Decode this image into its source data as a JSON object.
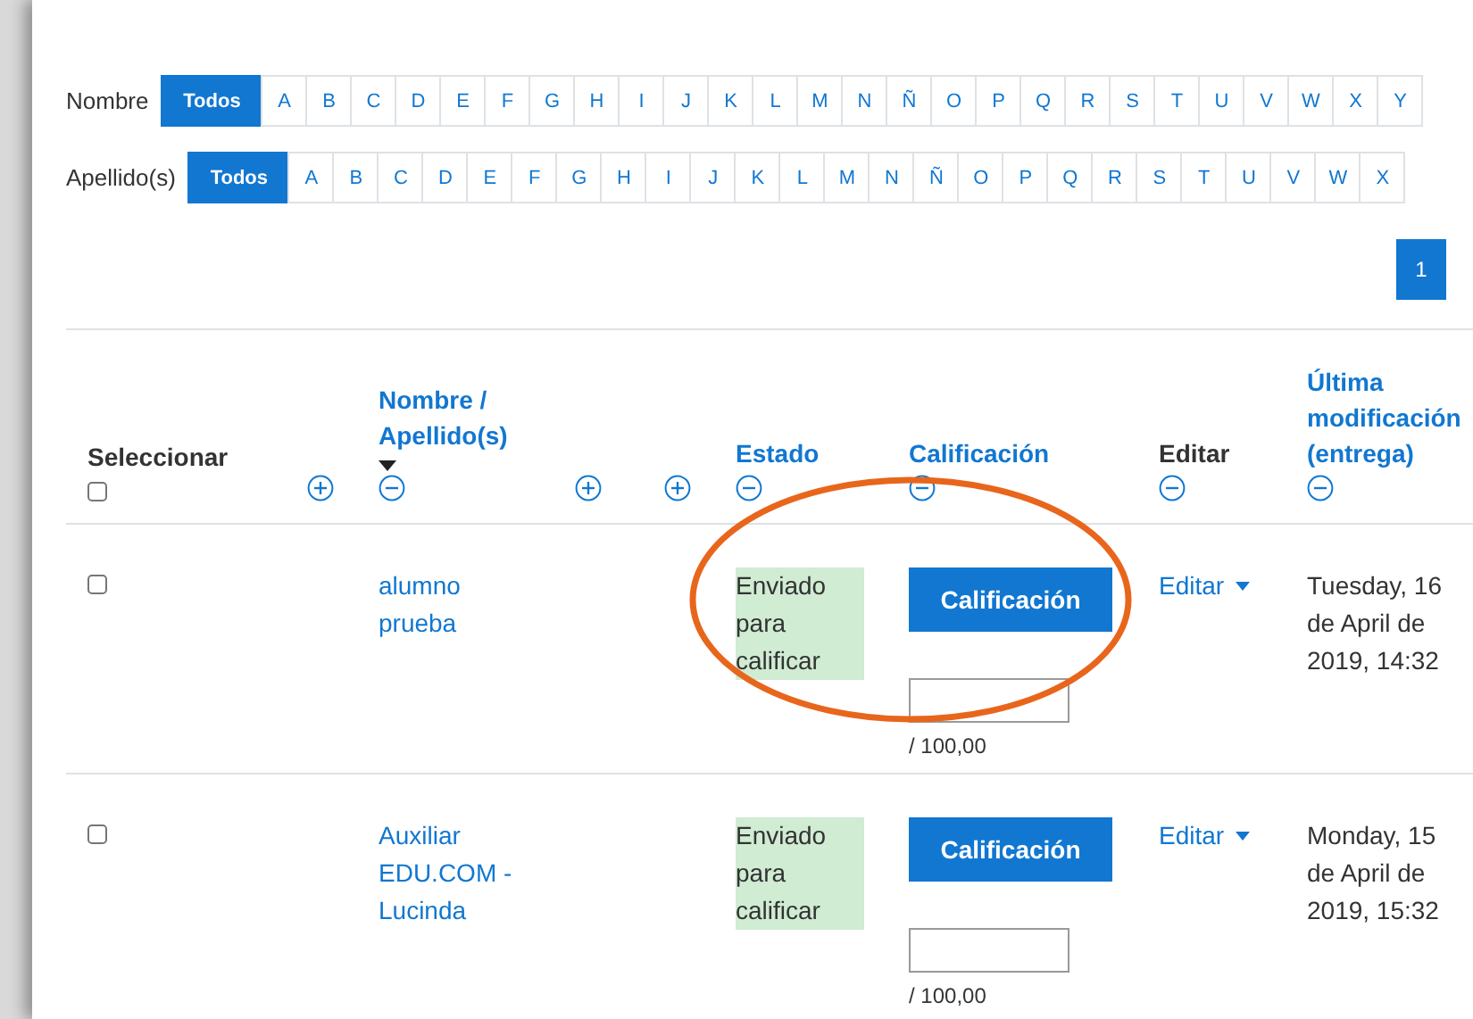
{
  "filters": [
    {
      "label": "Nombre",
      "letters": [
        {
          "text": "Todos",
          "selected": true
        },
        {
          "text": "A",
          "selected": false
        },
        {
          "text": "B",
          "selected": false
        },
        {
          "text": "C",
          "selected": false
        },
        {
          "text": "D",
          "selected": false
        },
        {
          "text": "E",
          "selected": false
        },
        {
          "text": "F",
          "selected": false
        },
        {
          "text": "G",
          "selected": false
        },
        {
          "text": "H",
          "selected": false
        },
        {
          "text": "I",
          "selected": false
        },
        {
          "text": "J",
          "selected": false
        },
        {
          "text": "K",
          "selected": false
        },
        {
          "text": "L",
          "selected": false
        },
        {
          "text": "M",
          "selected": false
        },
        {
          "text": "N",
          "selected": false
        },
        {
          "text": "Ñ",
          "selected": false
        },
        {
          "text": "O",
          "selected": false
        },
        {
          "text": "P",
          "selected": false
        },
        {
          "text": "Q",
          "selected": false
        },
        {
          "text": "R",
          "selected": false
        },
        {
          "text": "S",
          "selected": false
        },
        {
          "text": "T",
          "selected": false
        },
        {
          "text": "U",
          "selected": false
        },
        {
          "text": "V",
          "selected": false
        },
        {
          "text": "W",
          "selected": false
        },
        {
          "text": "X",
          "selected": false
        },
        {
          "text": "Y",
          "selected": false
        }
      ]
    },
    {
      "label": "Apellido(s)",
      "letters": [
        {
          "text": "Todos",
          "selected": true
        },
        {
          "text": "A",
          "selected": false
        },
        {
          "text": "B",
          "selected": false
        },
        {
          "text": "C",
          "selected": false
        },
        {
          "text": "D",
          "selected": false
        },
        {
          "text": "E",
          "selected": false
        },
        {
          "text": "F",
          "selected": false
        },
        {
          "text": "G",
          "selected": false
        },
        {
          "text": "H",
          "selected": false
        },
        {
          "text": "I",
          "selected": false
        },
        {
          "text": "J",
          "selected": false
        },
        {
          "text": "K",
          "selected": false
        },
        {
          "text": "L",
          "selected": false
        },
        {
          "text": "M",
          "selected": false
        },
        {
          "text": "N",
          "selected": false
        },
        {
          "text": "Ñ",
          "selected": false
        },
        {
          "text": "O",
          "selected": false
        },
        {
          "text": "P",
          "selected": false
        },
        {
          "text": "Q",
          "selected": false
        },
        {
          "text": "R",
          "selected": false
        },
        {
          "text": "S",
          "selected": false
        },
        {
          "text": "T",
          "selected": false
        },
        {
          "text": "U",
          "selected": false
        },
        {
          "text": "V",
          "selected": false
        },
        {
          "text": "W",
          "selected": false
        },
        {
          "text": "X",
          "selected": false
        }
      ]
    }
  ],
  "pagination": [
    {
      "text": "1",
      "selected": true
    }
  ],
  "table": {
    "columns": [
      {
        "kind": "select",
        "label": "Seleccionar",
        "checked": false
      },
      {
        "kind": "toggle",
        "collapsed": true
      },
      {
        "kind": "sort",
        "label": "Nombre / Apellido(s)",
        "sorted": true,
        "collapsed": false
      },
      {
        "kind": "toggle",
        "collapsed": true
      },
      {
        "kind": "toggle",
        "collapsed": true
      },
      {
        "kind": "sort",
        "label": "Estado",
        "sorted": false,
        "collapsed": false
      },
      {
        "kind": "sort",
        "label": "Calificación",
        "sorted": false,
        "collapsed": false
      },
      {
        "kind": "label",
        "label": "Editar",
        "collapsed": false
      },
      {
        "kind": "sort",
        "label": "Última modificación (entrega)",
        "sorted": false,
        "collapsed": false
      }
    ],
    "rows": [
      {
        "checked": false,
        "name": "alumno prueba",
        "status": "Enviado para calificar",
        "grade_button": "Calificación",
        "grade_max": "/ 100,00",
        "edit": "Editar",
        "modified": "Tuesday, 16 de April de 2019, 14:32"
      },
      {
        "checked": false,
        "name": "Auxiliar EDU.COM - Lucinda",
        "status": "Enviado para calificar",
        "grade_button": "Calificación",
        "grade_max": "/ 100,00",
        "edit": "Editar",
        "modified": "Monday, 15 de April de 2019, 15:32"
      }
    ]
  },
  "annotation": {
    "kind": "ellipse",
    "color": "#e8661c"
  }
}
